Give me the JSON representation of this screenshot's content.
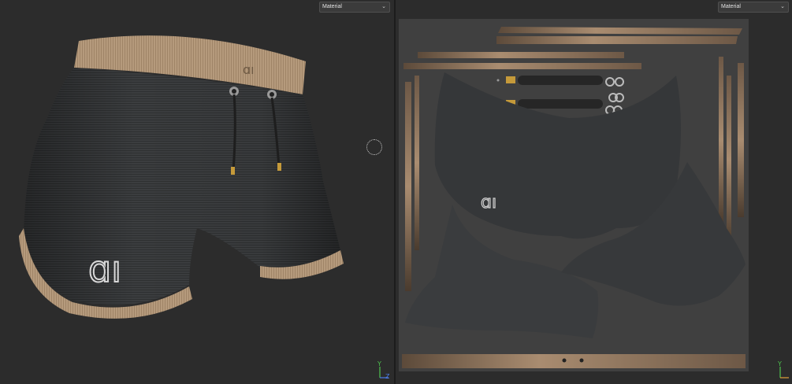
{
  "left_viewport": {
    "material_dropdown": {
      "selected": "Material"
    },
    "logo_text": "ɑı"
  },
  "right_viewport": {
    "material_dropdown": {
      "selected": "Material"
    },
    "logo_text": "ɑı"
  },
  "gizmo": {
    "y_label": "Y",
    "z_label": "Z"
  },
  "colors": {
    "background": "#2c2c2c",
    "fabric": "#3a3c3d",
    "trim": "#b99b7e",
    "uv_sheet": "#404040"
  },
  "icons": [
    "chevron-down-icon",
    "axis-gizmo-icon",
    "brush-cursor-icon"
  ]
}
